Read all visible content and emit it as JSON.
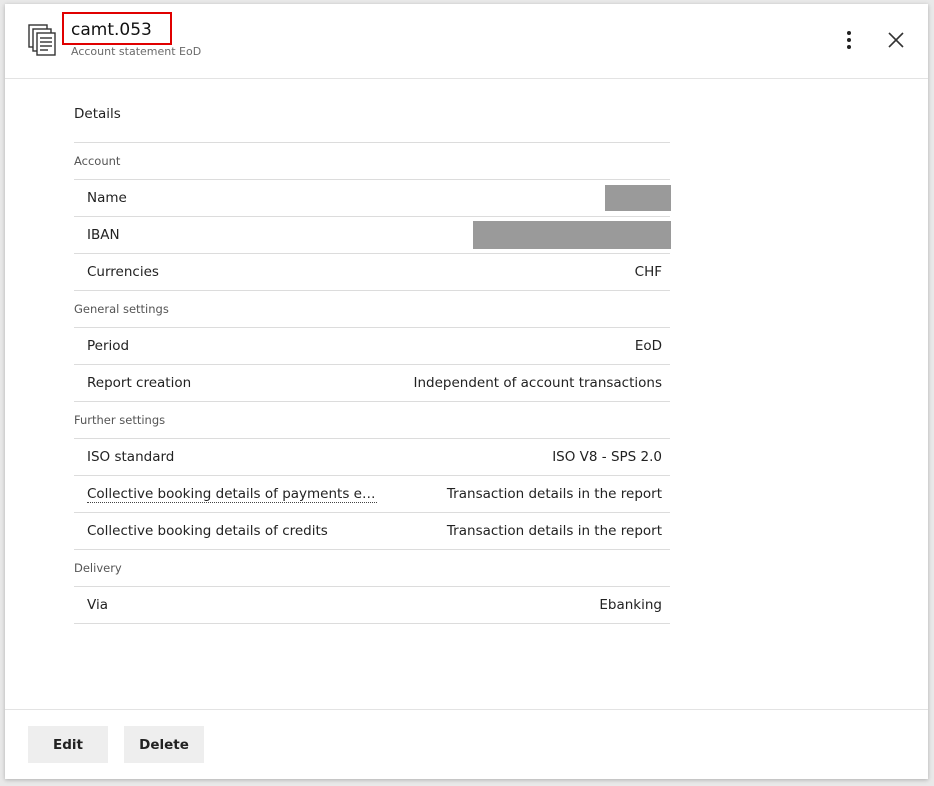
{
  "header": {
    "title": "camt.053",
    "subtitle": "Account statement EoD"
  },
  "details": {
    "section_title": "Details",
    "groups": [
      {
        "label": "Account",
        "rows": [
          {
            "label": "Name",
            "value": ""
          },
          {
            "label": "IBAN",
            "value": ""
          },
          {
            "label": "Currencies",
            "value": "CHF"
          }
        ]
      },
      {
        "label": "General settings",
        "rows": [
          {
            "label": "Period",
            "value": "EoD"
          },
          {
            "label": "Report creation",
            "value": "Independent of account transactions"
          }
        ]
      },
      {
        "label": "Further settings",
        "rows": [
          {
            "label": "ISO standard",
            "value": "ISO V8 - SPS 2.0"
          },
          {
            "label": "Collective booking details of payments en…",
            "value": "Transaction details in the report"
          },
          {
            "label": "Collective booking details of credits",
            "value": "Transaction details in the report"
          }
        ]
      },
      {
        "label": "Delivery",
        "rows": [
          {
            "label": "Via",
            "value": "Ebanking"
          }
        ]
      }
    ]
  },
  "footer": {
    "edit_label": "Edit",
    "delete_label": "Delete"
  },
  "icons": {
    "document": "document-icon",
    "more": "more-vertical-icon",
    "close": "close-icon"
  },
  "colors": {
    "highlight_border": "#e00000",
    "redaction": "#9a9a9a"
  }
}
